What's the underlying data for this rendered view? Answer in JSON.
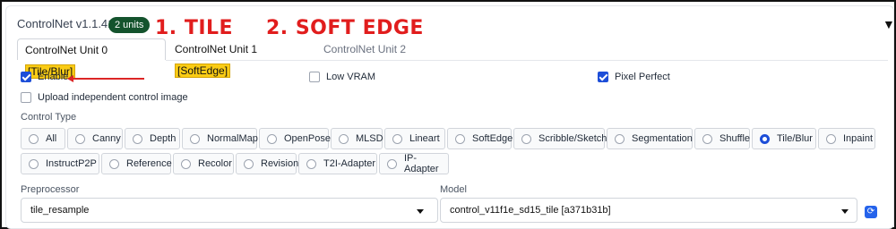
{
  "header": {
    "title": "ControlNet v1.1.417",
    "badge": "2 units",
    "collapse_icon": "triangle-down-icon"
  },
  "annotations": {
    "first": "1. TILE",
    "second": "2. SOFT EDGE"
  },
  "tabs": [
    {
      "label": "ControlNet Unit 0",
      "tag": "[Tile/Blur]",
      "active": true
    },
    {
      "label": "ControlNet Unit 1",
      "tag": "[SoftEdge]",
      "active": false
    },
    {
      "label": "ControlNet Unit 2",
      "tag": "",
      "active": false
    }
  ],
  "options": {
    "enable": {
      "label": "Enable",
      "checked": true
    },
    "low_vram": {
      "label": "Low VRAM",
      "checked": false
    },
    "pixel_perfect": {
      "label": "Pixel Perfect",
      "checked": true
    },
    "upload_independent": {
      "label": "Upload independent control image",
      "checked": false
    }
  },
  "control_type": {
    "label": "Control Type",
    "selected": "Tile/Blur",
    "row1": [
      "All",
      "Canny",
      "Depth",
      "NormalMap",
      "OpenPose",
      "MLSD",
      "Lineart",
      "SoftEdge",
      "Scribble/Sketch",
      "Segmentation",
      "Shuffle",
      "Tile/Blur",
      "Inpaint"
    ],
    "row2": [
      "InstructP2P",
      "Reference",
      "Recolor",
      "Revision",
      "T2I-Adapter",
      "IP-Adapter"
    ]
  },
  "preprocessor": {
    "label": "Preprocessor",
    "value": "tile_resample"
  },
  "model": {
    "label": "Model",
    "value": "control_v11f1e_sd15_tile [a371b31b]",
    "refresh_icon": "refresh-icon"
  },
  "colors": {
    "accent": "#1d4ed8",
    "badge": "#14532d",
    "annotation": "#e11d1d",
    "highlight": "#facc15"
  }
}
